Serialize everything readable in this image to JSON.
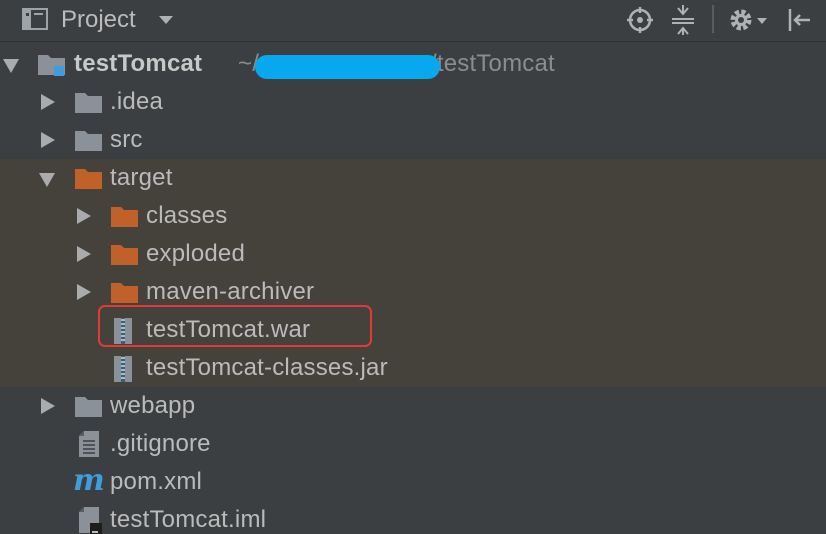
{
  "panel": {
    "title": "Project"
  },
  "toolbar": {
    "icons": [
      "locate-icon",
      "collapse-all-icon",
      "gear-icon",
      "hide-panel-icon"
    ]
  },
  "tree": {
    "root": {
      "name": "testTomcat",
      "path_prefix": "~/",
      "path_suffix": "/testTomcat"
    },
    "idea": ".idea",
    "src": "src",
    "target": "target",
    "classes": "classes",
    "exploded": "exploded",
    "maven_archiver": "maven-archiver",
    "war": "testTomcat.war",
    "jar": "testTomcat-classes.jar",
    "webapp": "webapp",
    "gitignore": ".gitignore",
    "pom": "pom.xml",
    "iml": "testTomcat.iml"
  },
  "colors": {
    "background": "#3c3f41",
    "highlight": "#45413b",
    "folder_grey": "#8a9199",
    "folder_orange": "#c0612a",
    "maven_blue": "#3f9ddb",
    "annotation_red": "#e53935",
    "redaction_blue": "#08a8ef"
  }
}
